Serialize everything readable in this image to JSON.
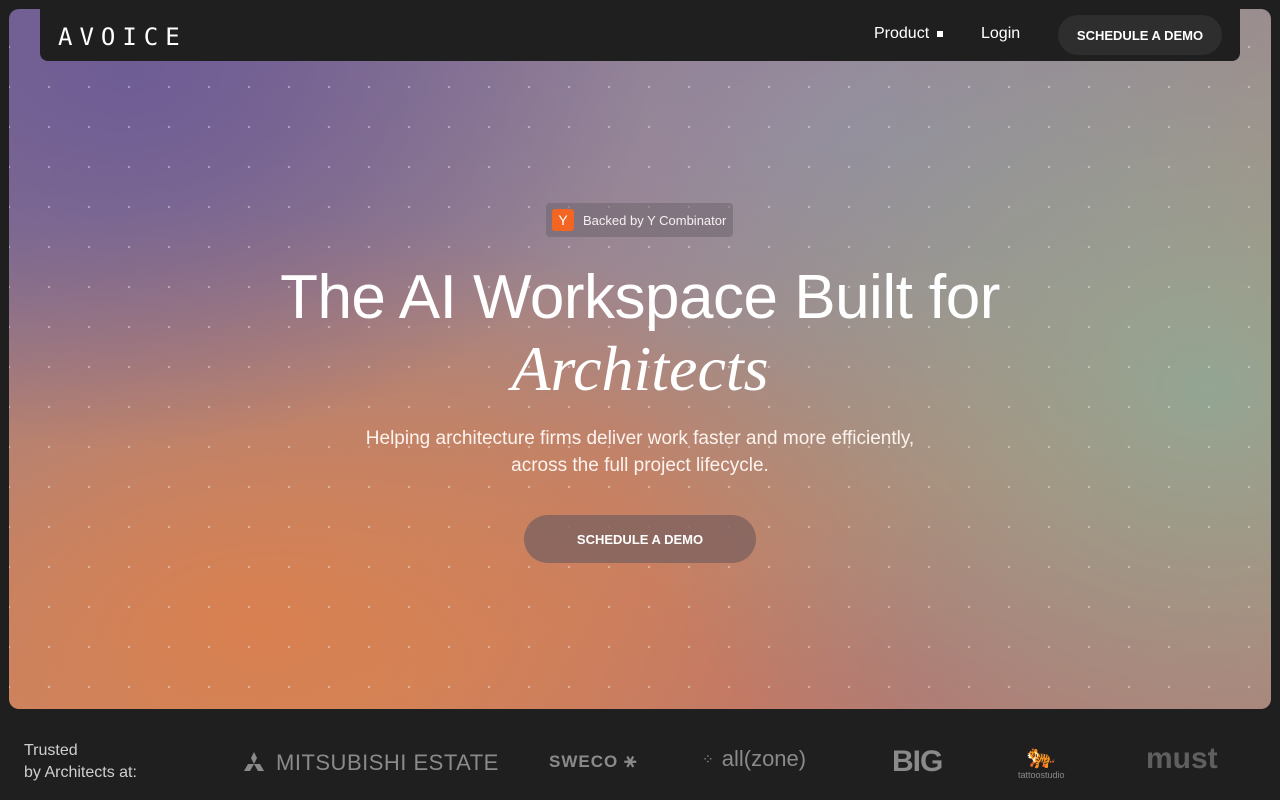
{
  "nav": {
    "logo": "AVOICE",
    "product": "Product",
    "login": "Login",
    "demo": "SCHEDULE A DEMO"
  },
  "hero": {
    "badge_icon": "Y",
    "badge_text": "Backed by Y Combinator",
    "headline": "The AI Workspace Built for",
    "headline_italic": "Architects",
    "subtitle": "Helping architecture firms deliver work faster and more efficiently, across the full project lifecycle.",
    "cta": "SCHEDULE A DEMO"
  },
  "trusted": {
    "line1": "Trusted",
    "line2": "by Architects at:",
    "logos": [
      "MITSUBISHI ESTATE",
      "SWECO",
      "all(zone)",
      "BIG",
      "tattoostudio",
      "must"
    ]
  },
  "colors": {
    "accent_yc": "#f26522",
    "nav_bg": "#1f1f1f",
    "page_bg": "#1f1f1f"
  }
}
